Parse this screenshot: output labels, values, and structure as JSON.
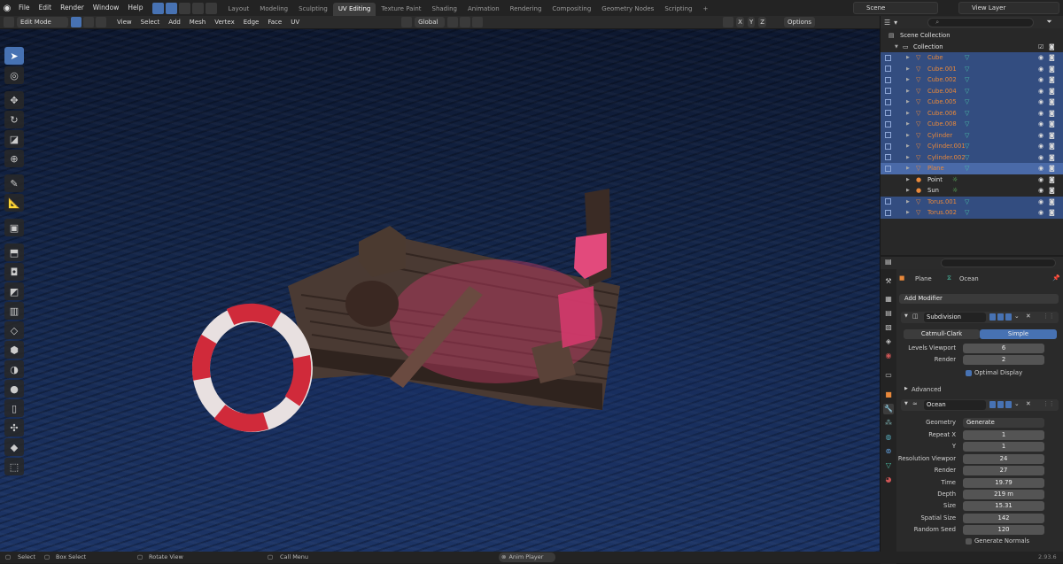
{
  "topbar": {
    "menus": [
      "File",
      "Edit",
      "Render",
      "Window",
      "Help"
    ],
    "workspaces": [
      "Layout",
      "Modeling",
      "Sculpting",
      "UV Editing",
      "Texture Paint",
      "Shading",
      "Animation",
      "Rendering",
      "Compositing",
      "Geometry Nodes",
      "Scripting"
    ],
    "active_workspace": "UV Editing",
    "add_tab": "+",
    "scene_label": "Scene",
    "view_layer_label": "View Layer"
  },
  "viewport_header": {
    "mode": "Edit Mode",
    "menus": [
      "View",
      "Select",
      "Add",
      "Mesh",
      "Vertex",
      "Edge",
      "Face",
      "UV"
    ],
    "transform_orientation": "Global",
    "axes": [
      "X",
      "Y",
      "Z"
    ],
    "options": "Options"
  },
  "outliner": {
    "scene_collection": "Scene Collection",
    "collection": "Collection",
    "items": [
      {
        "name": "Cube",
        "sel": true
      },
      {
        "name": "Cube.001",
        "sel": true
      },
      {
        "name": "Cube.002",
        "sel": true
      },
      {
        "name": "Cube.004",
        "sel": true
      },
      {
        "name": "Cube.005",
        "sel": true
      },
      {
        "name": "Cube.006",
        "sel": true
      },
      {
        "name": "Cube.008",
        "sel": true
      },
      {
        "name": "Cylinder",
        "sel": true
      },
      {
        "name": "Cylinder.001",
        "sel": true
      },
      {
        "name": "Cylinder.002",
        "sel": true
      },
      {
        "name": "Plane",
        "sel": true,
        "active": true
      },
      {
        "name": "Point",
        "sel": false
      },
      {
        "name": "Sun",
        "sel": false
      },
      {
        "name": "Torus.001",
        "sel": true
      },
      {
        "name": "Torus.002",
        "sel": true
      }
    ]
  },
  "properties": {
    "object_name": "Plane",
    "data_name": "Ocean",
    "add_modifier": "Add Modifier",
    "subdivision": {
      "name": "Subdivision",
      "catmull": "Catmull-Clark",
      "simple": "Simple",
      "levels_viewport_label": "Levels Viewport",
      "levels_viewport": "6",
      "render_label": "Render",
      "render": "2",
      "optimal_display": "Optimal Display",
      "advanced": "Advanced"
    },
    "ocean": {
      "name": "Ocean",
      "rows": [
        {
          "label": "Geometry",
          "value": "Generate"
        },
        {
          "label": "Repeat X",
          "value": "1"
        },
        {
          "label": "Y",
          "value": "1"
        },
        {
          "label": "Resolution Viewpor",
          "value": "24"
        },
        {
          "label": "Render",
          "value": "27"
        },
        {
          "label": "Time",
          "value": "19.79"
        },
        {
          "label": "Depth",
          "value": "219 m"
        },
        {
          "label": "Size",
          "value": "15.31"
        },
        {
          "label": "Spatial Size",
          "value": "142"
        },
        {
          "label": "Random Seed",
          "value": "120"
        }
      ],
      "generate_normals": "Generate Normals"
    }
  },
  "statusbar": {
    "select": "Select",
    "box_select": "Box Select",
    "rotate_view": "Rotate View",
    "call_menu": "Call Menu",
    "anim_player": "Anim Player",
    "version": "2.93.6"
  }
}
